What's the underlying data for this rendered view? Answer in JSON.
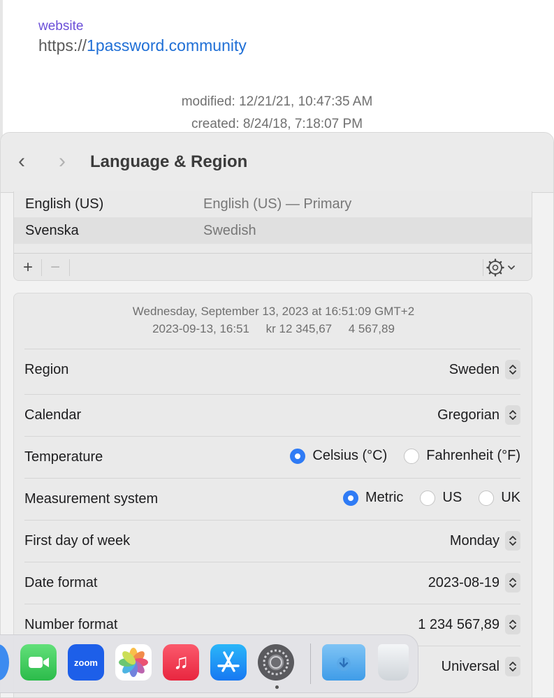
{
  "background_item": {
    "field_label": "website",
    "url_prefix": "https://",
    "url_link": "1password.community",
    "modified": "modified: 12/21/21, 10:47:35 AM",
    "created": "created: 8/24/18, 7:18:07 PM"
  },
  "toolbar": {
    "back_glyph": "‹",
    "forward_glyph": "›",
    "title": "Language & Region"
  },
  "languages": [
    {
      "name": "English (US)",
      "description": "English (US) — Primary"
    },
    {
      "name": "Svenska",
      "description": "Swedish"
    }
  ],
  "language_tools": {
    "add": "+",
    "remove": "−"
  },
  "preview": {
    "line1": "Wednesday, September 13, 2023 at 16:51:09 GMT+2",
    "line2": "2023-09-13, 16:51     kr 12 345,67     4 567,89"
  },
  "settings": {
    "region": {
      "label": "Region",
      "value": "Sweden"
    },
    "calendar": {
      "label": "Calendar",
      "value": "Gregorian"
    },
    "temperature": {
      "label": "Temperature",
      "options": [
        "Celsius (°C)",
        "Fahrenheit (°F)"
      ],
      "selected": "Celsius (°C)"
    },
    "measurement": {
      "label": "Measurement system",
      "options": [
        "Metric",
        "US",
        "UK"
      ],
      "selected": "Metric"
    },
    "first_day": {
      "label": "First day of week",
      "value": "Monday"
    },
    "date_format": {
      "label": "Date format",
      "value": "2023-08-19"
    },
    "number_format": {
      "label": "Number format",
      "value": "1 234 567,89"
    },
    "collation": {
      "value": "Universal"
    }
  },
  "dock": {
    "zoom_label": "zoom",
    "icons": [
      "safari-icon",
      "facetime-icon",
      "zoom-icon",
      "photos-icon",
      "music-icon",
      "app-store-icon",
      "system-settings-icon",
      "downloads-folder-icon",
      "trash-icon"
    ]
  },
  "colors": {
    "accent": "#2f7bf5",
    "link": "#1f6fd6",
    "field_label": "#6b4fd8"
  }
}
